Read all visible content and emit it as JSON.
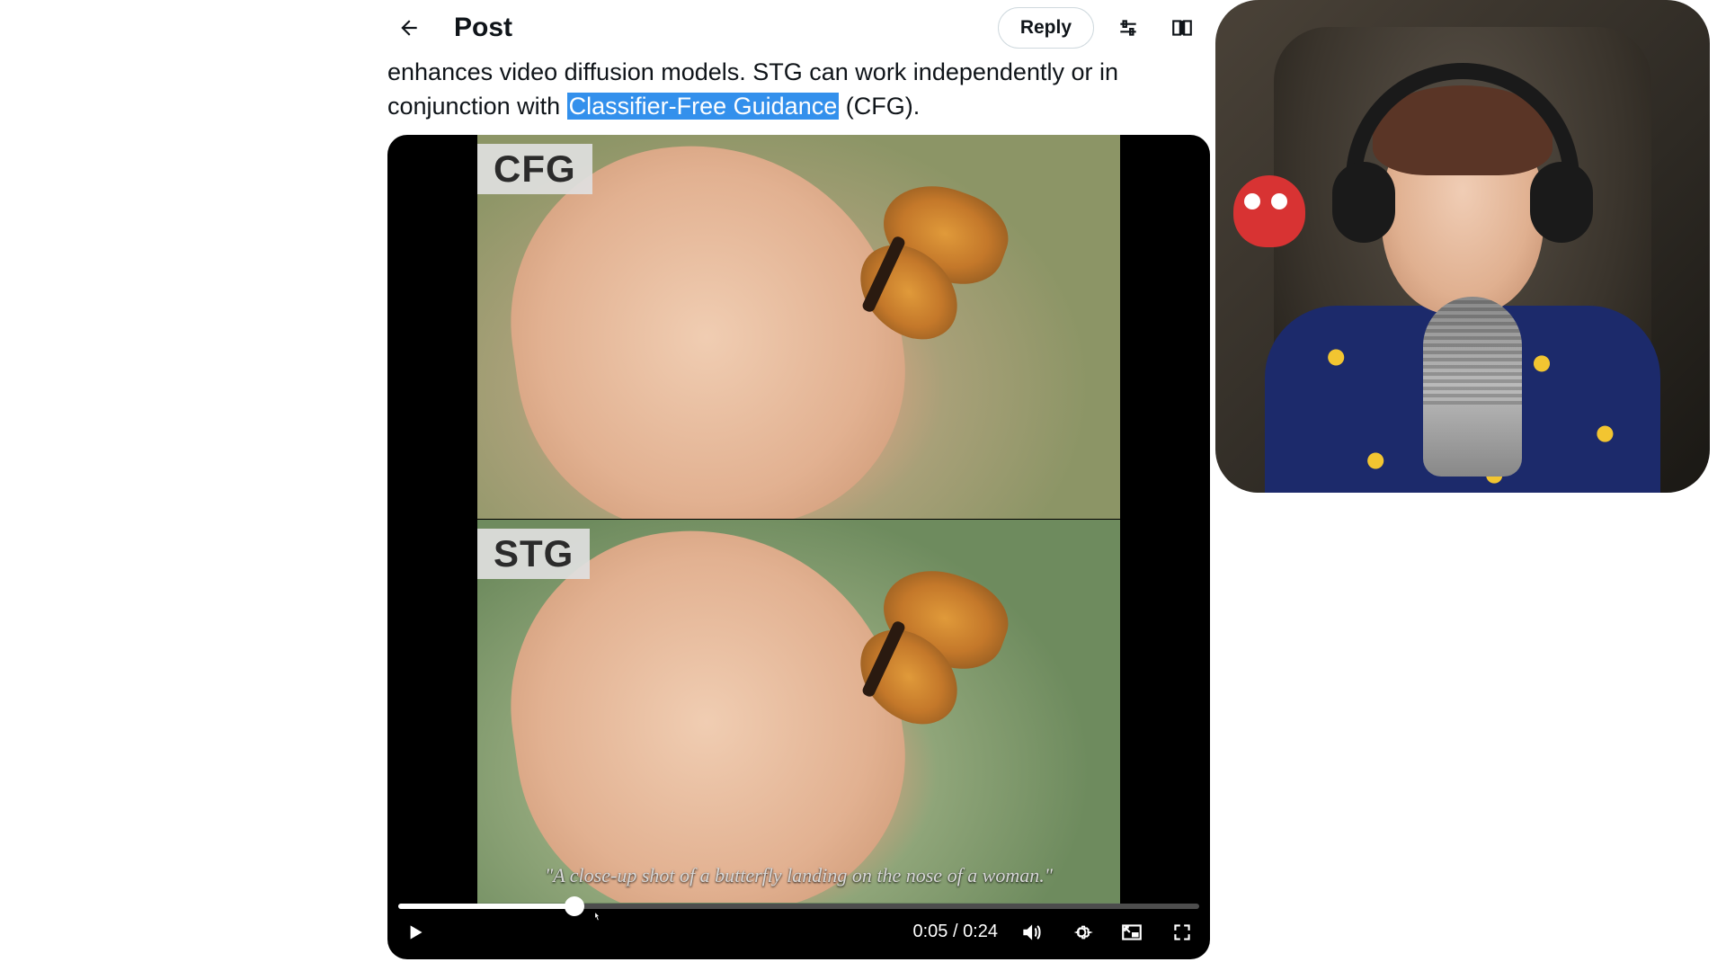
{
  "header": {
    "title": "Post",
    "reply_label": "Reply"
  },
  "post": {
    "text_line1": "enhances video diffusion models. STG can work independently or in",
    "text_line2_prefix": "conjunction with ",
    "text_line2_highlight": "Classifier-Free Guidance",
    "text_line2_suffix": " (CFG)."
  },
  "video": {
    "label_top": "CFG",
    "label_bottom": "STG",
    "caption": "\"A close-up shot of a butterfly landing on the nose of a woman.\"",
    "time_current": "0:05",
    "time_total": "0:24",
    "progress_percent": 22
  }
}
